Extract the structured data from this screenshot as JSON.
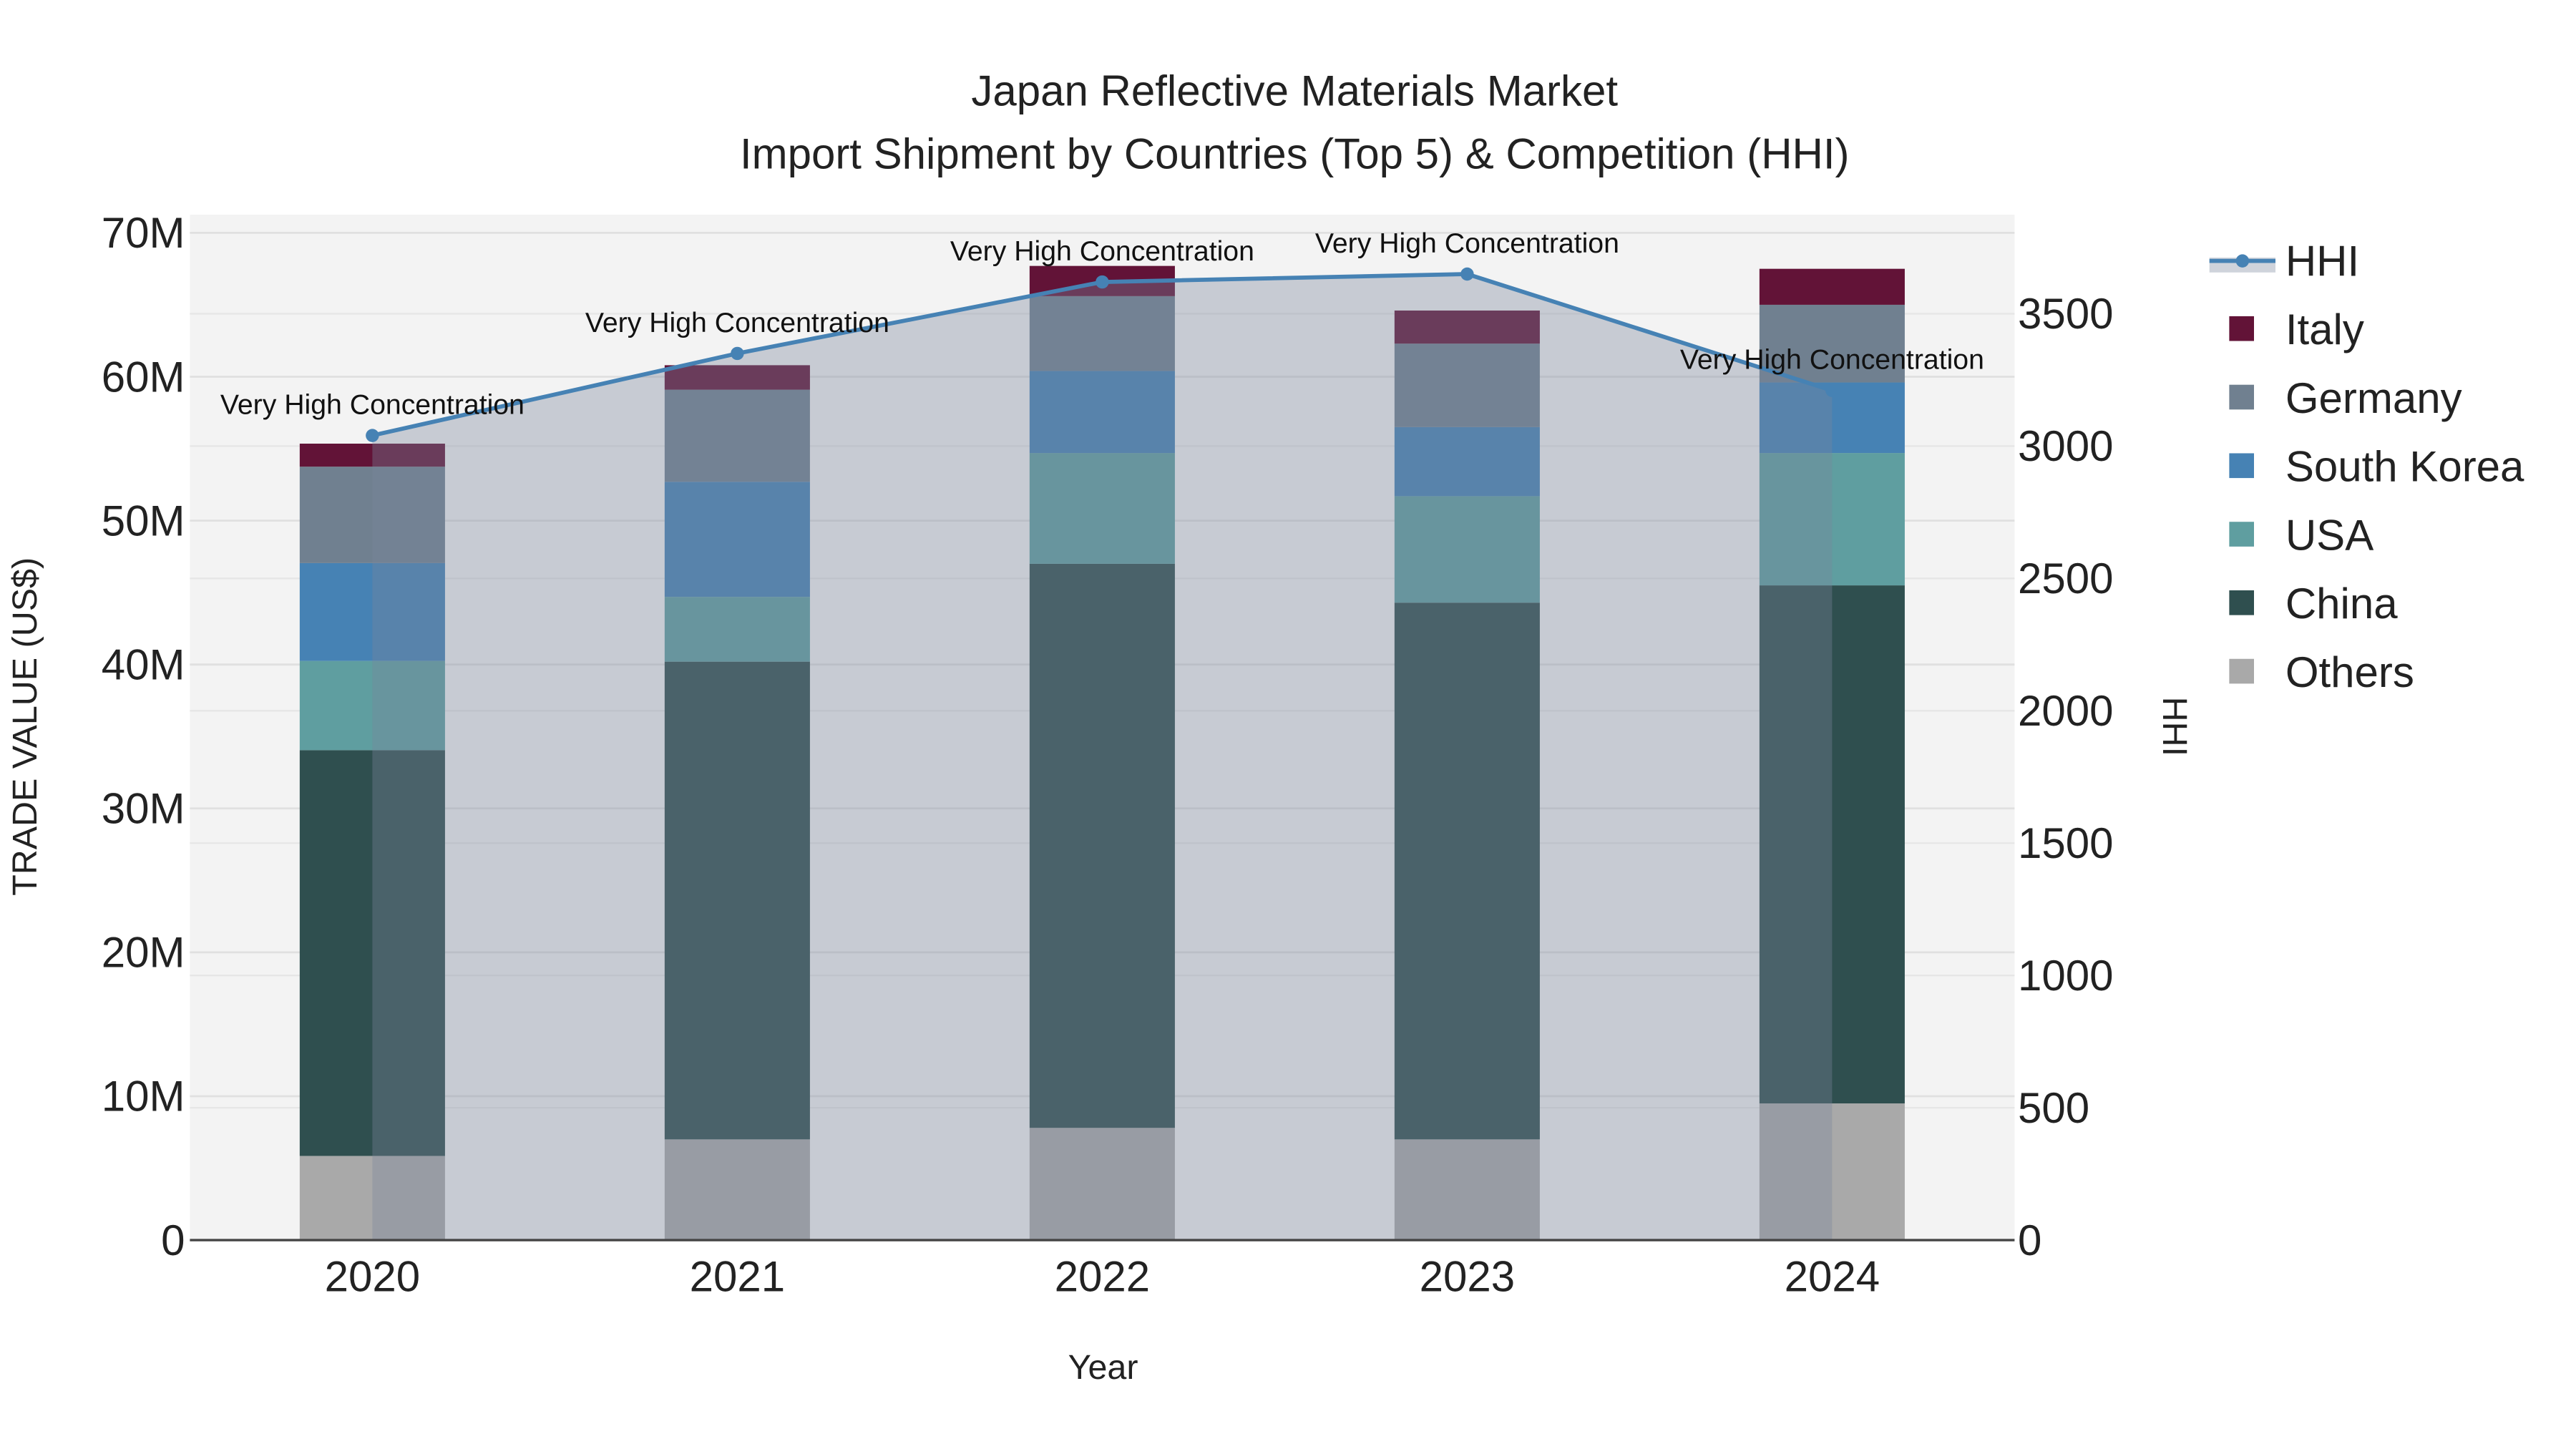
{
  "chart_data": {
    "type": "bar",
    "title": "Japan Reflective Materials Market",
    "subtitle": "Import Shipment by Countries (Top 5) & Competition (HHI)",
    "xlabel": "Year",
    "ylabel": "TRADE VALUE (US$)",
    "y2label": "HHI",
    "categories": [
      "2020",
      "2021",
      "2022",
      "2023",
      "2024"
    ],
    "ylim": [
      0,
      70000000
    ],
    "y2lim": [
      0,
      3800
    ],
    "yticks": [
      "0",
      "10M",
      "20M",
      "30M",
      "40M",
      "50M",
      "60M",
      "70M"
    ],
    "y2ticks": [
      "0",
      "500",
      "1000",
      "1500",
      "2000",
      "2500",
      "3000",
      "3500"
    ],
    "stacked": true,
    "series": [
      {
        "name": "Others",
        "color": "#a9a9a9",
        "values": [
          5.85,
          7.0,
          7.8,
          7.0,
          9.5
        ]
      },
      {
        "name": "China",
        "color": "#2f4f4f",
        "values": [
          28.2,
          33.2,
          39.2,
          37.3,
          36.0
        ]
      },
      {
        "name": "USA",
        "color": "#5f9ea0",
        "values": [
          6.2,
          4.5,
          7.7,
          7.4,
          9.2
        ]
      },
      {
        "name": "South Korea",
        "color": "#4682b4",
        "values": [
          6.8,
          8.0,
          5.7,
          4.8,
          4.9
        ]
      },
      {
        "name": "Germany",
        "color": "#708090",
        "values": [
          6.7,
          6.4,
          5.2,
          5.8,
          5.4
        ]
      },
      {
        "name": "Italy",
        "color": "#621337",
        "values": [
          1.6,
          1.7,
          2.1,
          2.3,
          2.5
        ]
      }
    ],
    "value_unit": "millions US$",
    "line": {
      "name": "HHI",
      "color": "#4682b4",
      "values": [
        3040,
        3350,
        3620,
        3650,
        3210
      ]
    },
    "annotations": [
      "Very High Concentration",
      "Very High Concentration",
      "Very High Concentration",
      "Very High Concentration",
      "Very High Concentration"
    ],
    "legend_order": [
      "HHI",
      "Italy",
      "Germany",
      "South Korea",
      "USA",
      "China",
      "Others"
    ],
    "legend_position": "right",
    "grid": true
  }
}
